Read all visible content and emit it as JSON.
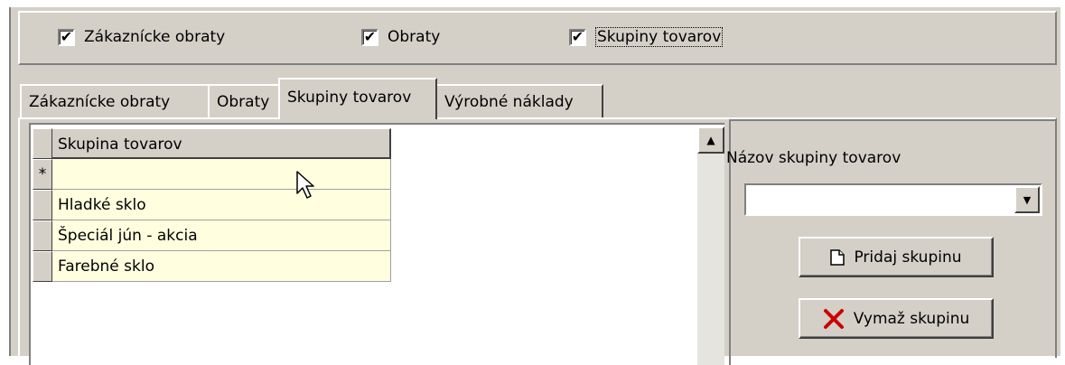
{
  "checkboxes": [
    {
      "label": "Zákaznícke obraty",
      "checked": true
    },
    {
      "label": "Obraty",
      "checked": true
    },
    {
      "label": "Skupiny tovarov",
      "checked": true
    }
  ],
  "tabs": [
    {
      "label": "Zákaznícke obraty"
    },
    {
      "label": "Obraty"
    },
    {
      "label": "Skupiny tovarov",
      "active": true
    },
    {
      "label": "Výrobné náklady"
    }
  ],
  "grid": {
    "header": "Skupina tovarov",
    "new_row_marker": "*",
    "rows": [
      {
        "value": ""
      },
      {
        "value": "Hladké sklo"
      },
      {
        "value": "Špeciál jún - akcia"
      },
      {
        "value": "Farebné sklo"
      }
    ]
  },
  "right": {
    "label": "Názov skupiny tovarov",
    "combo_value": "",
    "add_button": "Pridaj skupinu",
    "delete_button": "Vymaž skupinu"
  },
  "icons": {
    "checkmark": "✔",
    "scroll_up": "▲",
    "combo_arrow": "▼",
    "add": "new-document-icon",
    "delete": "red-x-icon"
  },
  "colors": {
    "window_bg": "#d4d0c8",
    "grid_cell_bg": "#ffffe0",
    "delete_icon": "#cc0000"
  }
}
